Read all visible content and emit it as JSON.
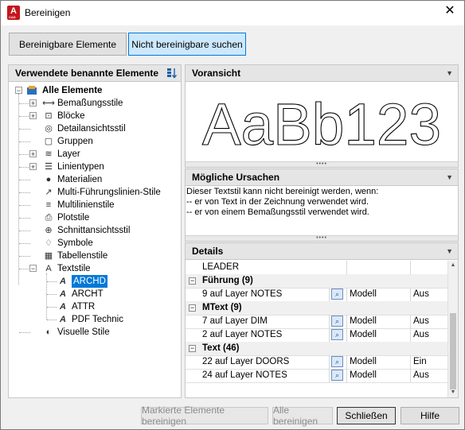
{
  "window": {
    "title": "Bereinigen",
    "close_glyph": "✕"
  },
  "tabs": [
    {
      "label": "Bereinigbare Elemente"
    },
    {
      "label": "Nicht bereinigbare suchen"
    }
  ],
  "tree_panel": {
    "title": "Verwendete benannte Elemente",
    "root": "Alle Elemente",
    "items": [
      {
        "label": "Bemaßungsstile",
        "icon": "dimension-style-icon"
      },
      {
        "label": "Blöcke",
        "icon": "block-icon"
      },
      {
        "label": "Detailansichtsstil",
        "icon": "detail-view-icon"
      },
      {
        "label": "Gruppen",
        "icon": "group-icon"
      },
      {
        "label": "Layer",
        "icon": "layer-icon"
      },
      {
        "label": "Linientypen",
        "icon": "linetype-icon"
      },
      {
        "label": "Materialien",
        "icon": "material-icon"
      },
      {
        "label": "Multi-Führungslinien-Stile",
        "icon": "multileader-icon"
      },
      {
        "label": "Multilinienstile",
        "icon": "multiline-icon"
      },
      {
        "label": "Plotstile",
        "icon": "plotstyle-icon"
      },
      {
        "label": "Schnittansichtsstil",
        "icon": "section-view-icon"
      },
      {
        "label": "Symbole",
        "icon": "symbol-icon"
      },
      {
        "label": "Tabellenstile",
        "icon": "table-style-icon"
      },
      {
        "label": "Textstile",
        "icon": "text-style-icon"
      },
      {
        "label": "Visuelle Stile",
        "icon": "visual-style-icon"
      }
    ],
    "textstyles": [
      "ARCHD",
      "ARCHT",
      "ATTR",
      "PDF Technic"
    ]
  },
  "preview_panel": {
    "title": "Voransicht",
    "sample": "AaBb123"
  },
  "reasons_panel": {
    "title": "Mögliche Ursachen",
    "lines": [
      "Dieser Textstil kann nicht bereinigt werden, wenn:",
      "-- er von Text in der Zeichnung verwendet wird.",
      "-- er von einem Bemaßungsstil verwendet wird."
    ]
  },
  "details_panel": {
    "title": "Details",
    "top_row": "LEADER",
    "groups": [
      {
        "name": "Führung (9)",
        "rows": [
          {
            "name": "9 auf Layer NOTES",
            "space": "Modell",
            "state": "Aus"
          }
        ]
      },
      {
        "name": "MText (9)",
        "rows": [
          {
            "name": "7 auf Layer DIM",
            "space": "Modell",
            "state": "Aus"
          },
          {
            "name": "2 auf Layer NOTES",
            "space": "Modell",
            "state": "Aus"
          }
        ]
      },
      {
        "name": "Text (46)",
        "rows": [
          {
            "name": "22 auf Layer DOORS",
            "space": "Modell",
            "state": "Ein"
          },
          {
            "name": "24 auf Layer NOTES",
            "space": "Modell",
            "state": "Aus"
          }
        ]
      }
    ]
  },
  "buttons": {
    "purge_marked": "Markierte Elemente bereinigen",
    "purge_all": "Alle bereinigen",
    "close": "Schließen",
    "help": "Hilfe"
  },
  "colors": {
    "accent": "#0078d7",
    "brand": "#c4161c",
    "active_tab": "#cce8ff"
  }
}
